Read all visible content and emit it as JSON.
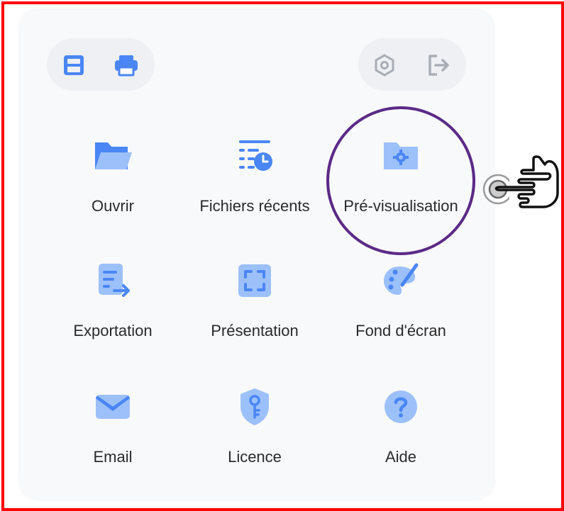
{
  "toolbar": {
    "left_icons": [
      "save-icon",
      "print-icon"
    ],
    "right_icons": [
      "settings-icon",
      "exit-icon"
    ]
  },
  "menu": {
    "items": [
      {
        "label": "Ouvrir",
        "icon": "folder-open-icon"
      },
      {
        "label": "Fichiers récents",
        "icon": "recent-files-icon"
      },
      {
        "label": "Pré-visualisation",
        "icon": "preview-folder-icon"
      },
      {
        "label": "Exportation",
        "icon": "export-icon"
      },
      {
        "label": "Présentation",
        "icon": "presentation-icon"
      },
      {
        "label": "Fond d'écran",
        "icon": "wallpaper-palette-icon"
      },
      {
        "label": "Email",
        "icon": "email-icon"
      },
      {
        "label": "Licence",
        "icon": "license-key-icon"
      },
      {
        "label": "Aide",
        "icon": "help-icon"
      }
    ]
  },
  "colors": {
    "icon_primary": "#4a86f5",
    "icon_light": "#9cc0fa",
    "highlight_circle": "#5b2a86",
    "frame": "#ff0000"
  }
}
